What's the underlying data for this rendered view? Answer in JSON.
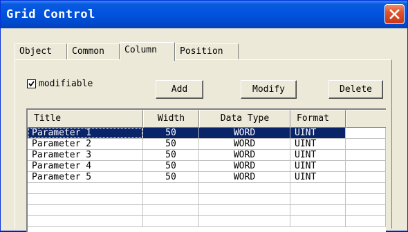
{
  "window": {
    "title": "Grid Control"
  },
  "tabs": [
    {
      "label": "Object"
    },
    {
      "label": "Common"
    },
    {
      "label": "Column"
    },
    {
      "label": "Position"
    }
  ],
  "active_tab": "Column",
  "modifiable": {
    "label": "modifiable",
    "checked": true
  },
  "buttons": {
    "add": "Add",
    "modify": "Modify",
    "delete": "Delete"
  },
  "table": {
    "headers": [
      "Title",
      "Width",
      "Data Type",
      "Format"
    ],
    "rows": [
      [
        "Parameter 1",
        "50",
        "WORD",
        "UINT"
      ],
      [
        "Parameter 2",
        "50",
        "WORD",
        "UINT"
      ],
      [
        "Parameter 3",
        "50",
        "WORD",
        "UINT"
      ],
      [
        "Parameter 4",
        "50",
        "WORD",
        "UINT"
      ],
      [
        "Parameter 5",
        "50",
        "WORD",
        "UINT"
      ]
    ],
    "selected_row": 0
  },
  "colors": {
    "title_bar": "#0052dd",
    "selection": "#0a246a",
    "face": "#ece9d8",
    "close": "#e0522b"
  }
}
